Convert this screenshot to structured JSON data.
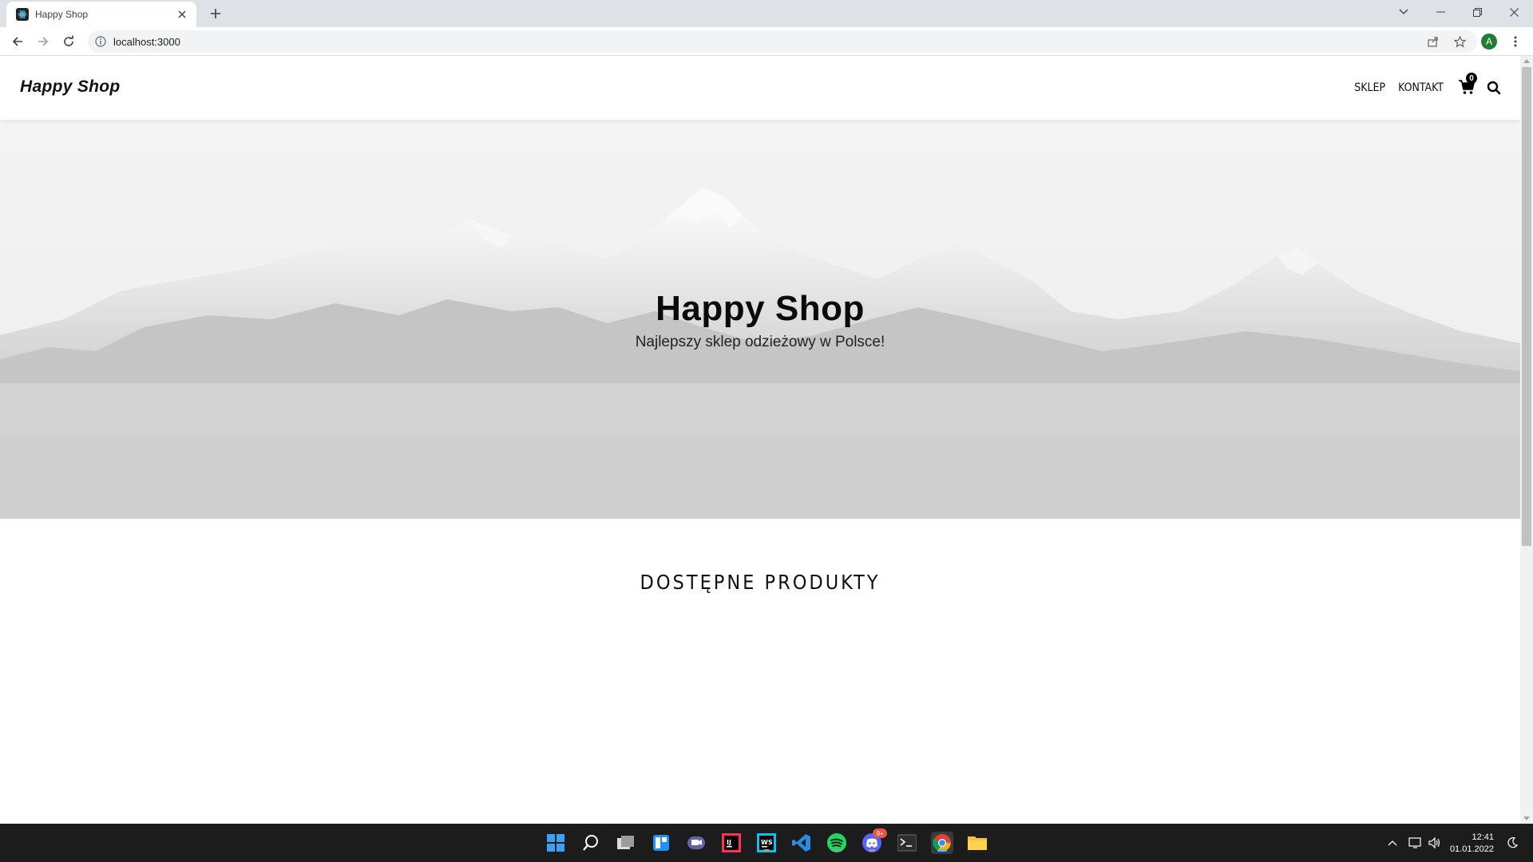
{
  "browser": {
    "tab_title": "Happy Shop",
    "url": "localhost:3000",
    "profile_initial": "A"
  },
  "site": {
    "logo": "Happy Shop",
    "nav": [
      {
        "label": "SKLEP"
      },
      {
        "label": "KONTAKT"
      }
    ],
    "cart_count": "0"
  },
  "hero": {
    "title": "Happy Shop",
    "subtitle": "Najlepszy sklep odzieżowy w Polsce!"
  },
  "products": {
    "section_title": "DOSTĘPNE PRODUKTY"
  },
  "taskbar": {
    "apps": [
      "start-icon",
      "search-icon",
      "task-view-icon",
      "widgets-icon",
      "teams-chat-icon",
      "intellij-icon",
      "webstorm-icon",
      "vscode-icon",
      "spotify-icon",
      "discord-icon",
      "terminal-icon",
      "chrome-icon",
      "file-explorer-icon"
    ],
    "discord_badge": "9+",
    "time": "12:41",
    "date": "01.01.2022"
  },
  "colors": {
    "accent": "#000000",
    "chrome_tabbar": "#dee1e6",
    "taskbar": "#1c1c1c"
  }
}
